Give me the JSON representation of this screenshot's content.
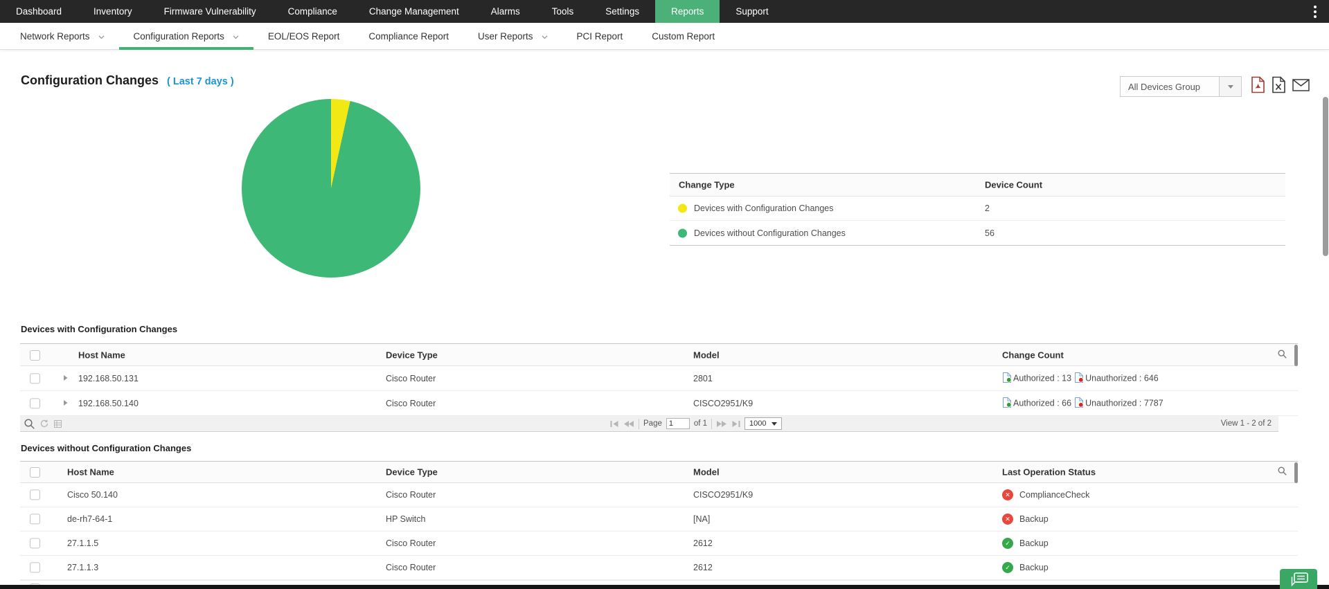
{
  "topnav": {
    "items": [
      "Dashboard",
      "Inventory",
      "Firmware Vulnerability",
      "Compliance",
      "Change Management",
      "Alarms",
      "Tools",
      "Settings",
      "Reports",
      "Support"
    ],
    "active": "Reports"
  },
  "subnav": {
    "items": [
      {
        "label": "Network Reports",
        "dropdown": true,
        "active": false
      },
      {
        "label": "Configuration Reports",
        "dropdown": true,
        "active": true
      },
      {
        "label": "EOL/EOS Report",
        "dropdown": false,
        "active": false
      },
      {
        "label": "Compliance Report",
        "dropdown": false,
        "active": false
      },
      {
        "label": "User Reports",
        "dropdown": true,
        "active": false
      },
      {
        "label": "PCI Report",
        "dropdown": false,
        "active": false
      },
      {
        "label": "Custom Report",
        "dropdown": false,
        "active": false
      }
    ]
  },
  "page": {
    "title": "Configuration Changes",
    "period": "( Last 7 days )",
    "group_selector": "All Devices Group",
    "export_icons": [
      "pdf-export-icon",
      "excel-export-icon",
      "email-export-icon"
    ]
  },
  "chart_data": {
    "type": "pie",
    "title": "Configuration Changes ( Last 7 days )",
    "labels": [
      "Devices with Configuration Changes",
      "Devices without Configuration Changes"
    ],
    "values": [
      2,
      56
    ],
    "colors": [
      "#f2e816",
      "#3eb877"
    ],
    "legend_position": "right-table"
  },
  "legend": {
    "headers": [
      "Change Type",
      "Device Count"
    ],
    "rows": [
      {
        "label": "Devices with Configuration Changes",
        "count": "2",
        "color": "#f2e816"
      },
      {
        "label": "Devices without Configuration Changes",
        "count": "56",
        "color": "#3eb877"
      }
    ]
  },
  "table_with": {
    "title": "Devices with Configuration Changes",
    "headers": [
      "Host Name",
      "Device Type",
      "Model",
      "Change Count"
    ],
    "rows": [
      {
        "host": "192.168.50.131",
        "type": "Cisco Router",
        "model": "2801",
        "authorized": "Authorized : 13",
        "unauthorized": "Unauthorized : 646"
      },
      {
        "host": "192.168.50.140",
        "type": "Cisco Router",
        "model": "CISCO2951/K9",
        "authorized": "Authorized : 66",
        "unauthorized": "Unauthorized : 7787"
      }
    ]
  },
  "pager": {
    "page_label": "Page",
    "page_value": "1",
    "of_label": "of 1",
    "page_size": "1000",
    "view_label": "View 1 - 2 of 2"
  },
  "table_without": {
    "title": "Devices without Configuration Changes",
    "headers": [
      "Host Name",
      "Device Type",
      "Model",
      "Last Operation Status"
    ],
    "rows": [
      {
        "host": "Cisco 50.140",
        "type": "Cisco Router",
        "model": "CISCO2951/K9",
        "status": "ComplianceCheck",
        "status_ok": false
      },
      {
        "host": "de-rh7-64-1",
        "type": "HP Switch",
        "model": "[NA]",
        "status": "Backup",
        "status_ok": false
      },
      {
        "host": "27.1.1.5",
        "type": "Cisco Router",
        "model": "2612",
        "status": "Backup",
        "status_ok": true
      },
      {
        "host": "27.1.1.3",
        "type": "Cisco Router",
        "model": "2612",
        "status": "Backup",
        "status_ok": true
      }
    ]
  },
  "colors": {
    "nav_bg": "#272727",
    "accent_green": "#4bb179",
    "link_blue": "#1d94d2",
    "status_ok": "#35a84c",
    "status_fail": "#e8483b",
    "authorized_icon": "#2f9e2f",
    "unauthorized_icon": "#cc2b24"
  }
}
